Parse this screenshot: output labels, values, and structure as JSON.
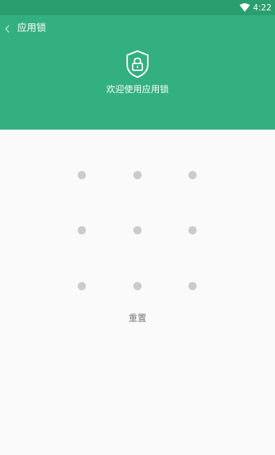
{
  "status_bar": {
    "wifi_icon": "wifi-icon",
    "time": "4:22"
  },
  "header": {
    "back_icon": "chevron-left-icon",
    "title": "应用锁",
    "shield_icon": "shield-lock-icon",
    "welcome": "欢迎使用应用锁",
    "color": "#33b07f"
  },
  "pattern": {
    "rows": 3,
    "cols": 3,
    "dot_color": "#cbcbcb"
  },
  "actions": {
    "reset_label": "重置"
  }
}
